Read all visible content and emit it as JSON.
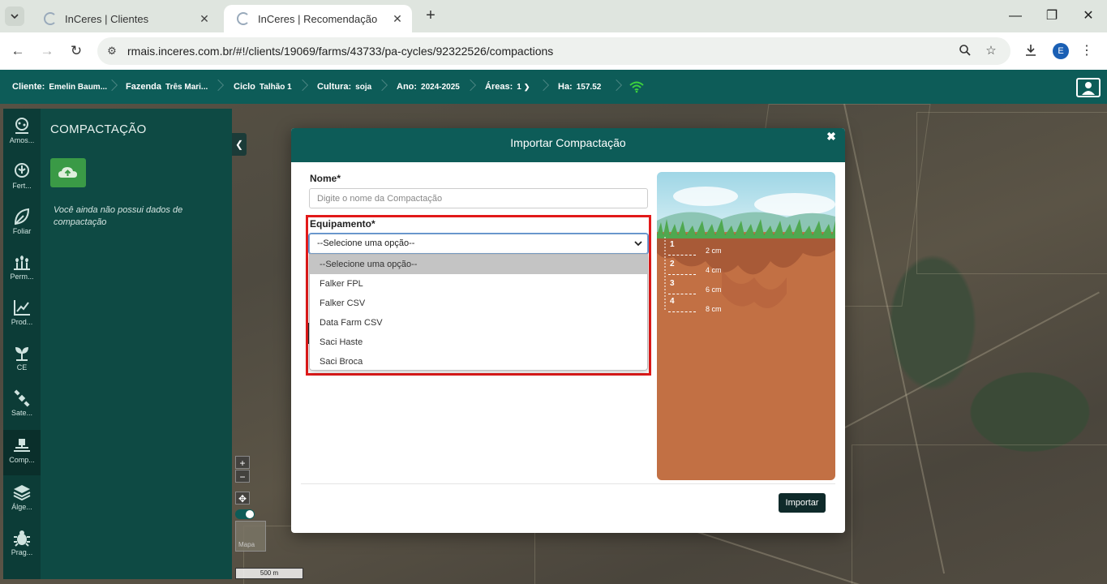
{
  "browser": {
    "tabs": [
      {
        "title": "InCeres | Clientes",
        "active": false
      },
      {
        "title": "InCeres | Recomendação",
        "active": true
      }
    ],
    "url": "rmais.inceres.com.br/#!/clients/19069/farms/43733/pa-cycles/92322526/compactions",
    "profile_initial": "E"
  },
  "header": {
    "cliente_label": "Cliente:",
    "cliente_value": "Emelin Baum...",
    "fazenda_label": "Fazenda",
    "fazenda_value": "Três Mari...",
    "ciclo_label": "Ciclo",
    "ciclo_value": "Talhão 1",
    "cultura_label": "Cultura:",
    "cultura_value": "soja",
    "ano_label": "Ano:",
    "ano_value": "2024-2025",
    "areas_label": "Áreas:",
    "areas_value": "1",
    "ha_label": "Ha:",
    "ha_value": "157.52"
  },
  "sidenav": [
    {
      "label": "Amos...",
      "icon": "sampling-icon"
    },
    {
      "label": "Fert...",
      "icon": "fertilizer-icon"
    },
    {
      "label": "Foliar",
      "icon": "leaf-icon"
    },
    {
      "label": "Perm...",
      "icon": "plants-icon"
    },
    {
      "label": "Prod...",
      "icon": "chart-line-icon"
    },
    {
      "label": "CE",
      "icon": "sprout-icon"
    },
    {
      "label": "Sate...",
      "icon": "satellite-icon"
    },
    {
      "label": "Comp...",
      "icon": "compaction-icon"
    },
    {
      "label": "Álge...",
      "icon": "layers-icon"
    },
    {
      "label": "Prag...",
      "icon": "bug-icon"
    }
  ],
  "panel": {
    "title": "COMPACTAÇÃO",
    "empty_message": "Você ainda não possui dados de compactação"
  },
  "map": {
    "scale_label": "500 m",
    "minimap_label": "Mapa"
  },
  "modal": {
    "title": "Importar Compactação",
    "nome_label": "Nome*",
    "nome_placeholder": "Digite o nome da Compactação",
    "equipamento_label": "Equipamento*",
    "selected_option": "--Selecione uma opção--",
    "options": [
      "--Selecione uma opção--",
      "Falker FPL",
      "Falker CSV",
      "Data Farm CSV",
      "Saci Haste",
      "Saci Broca"
    ],
    "import_button": "Importar",
    "depths": [
      {
        "num": "1",
        "cm": "2 cm"
      },
      {
        "num": "2",
        "cm": "4 cm"
      },
      {
        "num": "3",
        "cm": "6 cm"
      },
      {
        "num": "4",
        "cm": "8 cm"
      }
    ]
  },
  "colors": {
    "brand": "#0d5c58",
    "highlight": "#e21a1a",
    "upload": "#3a9a46",
    "wifi": "#3dd13d"
  }
}
